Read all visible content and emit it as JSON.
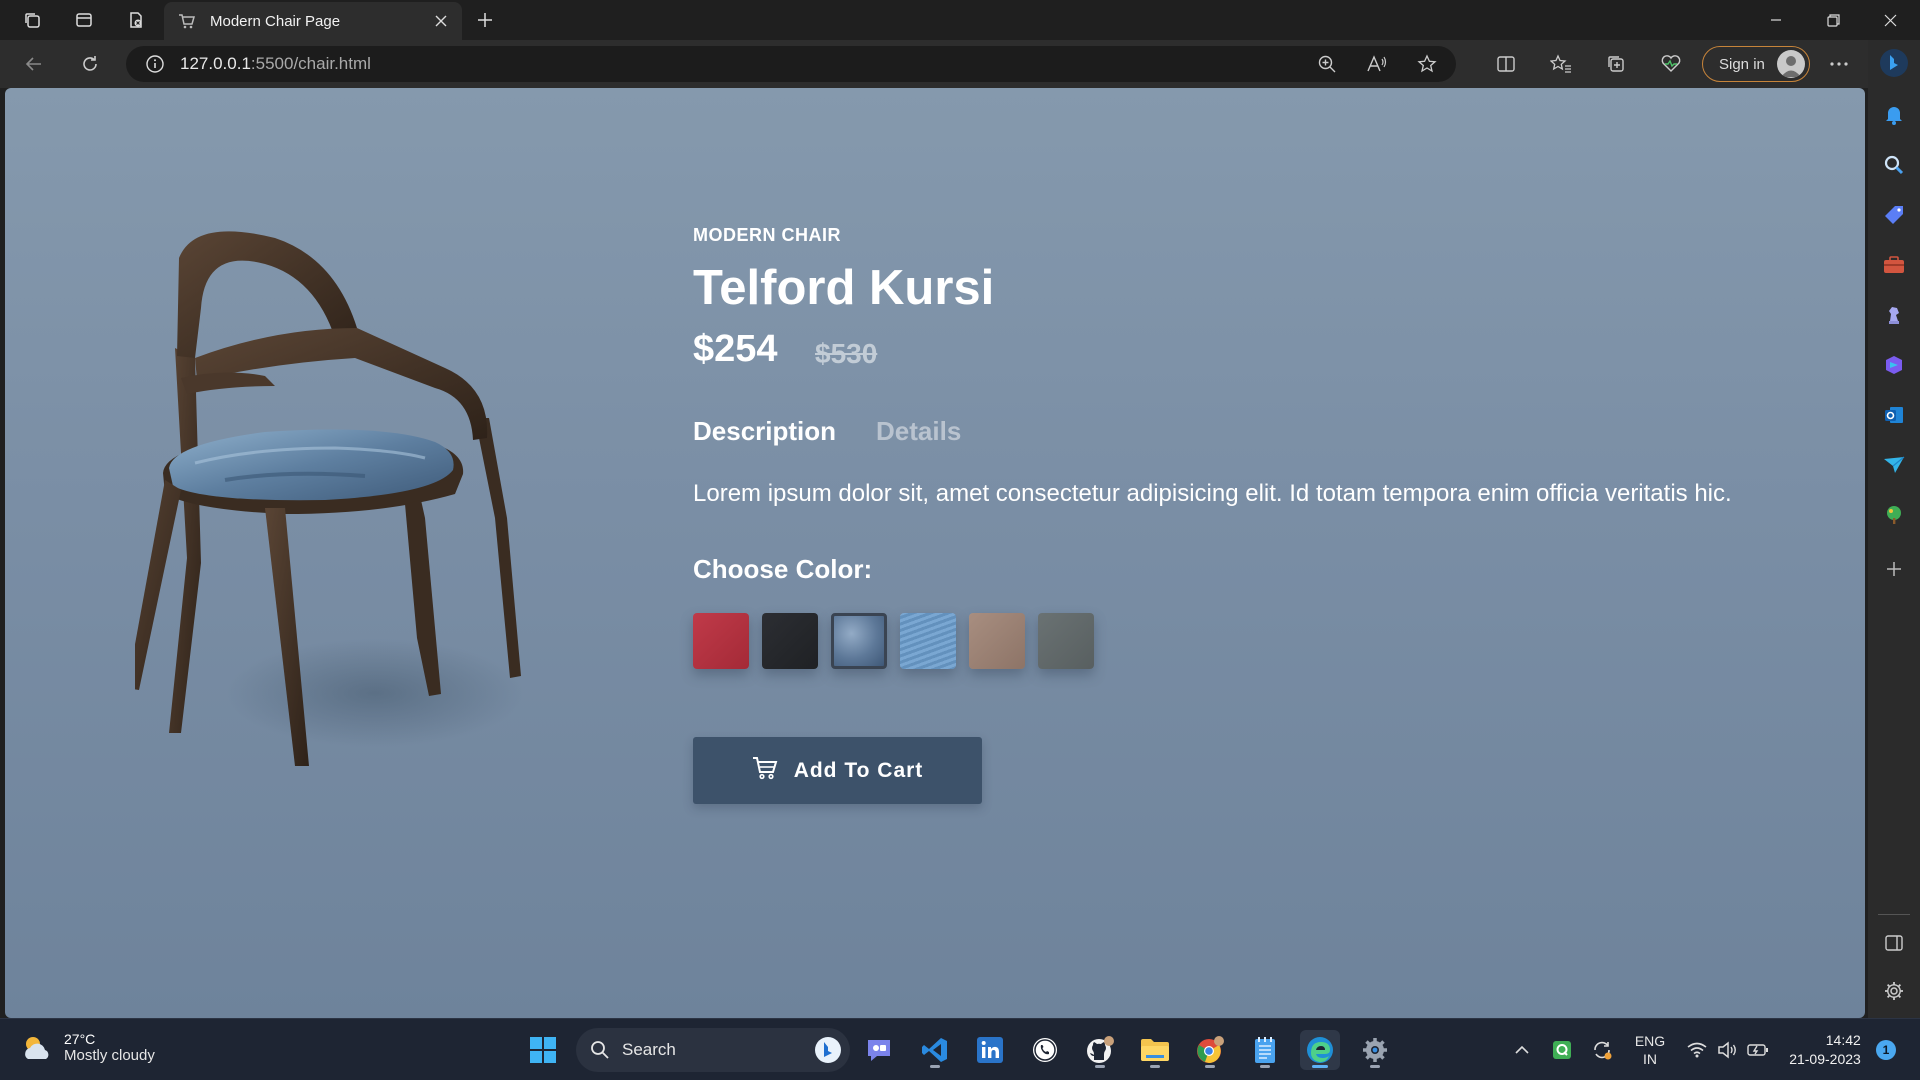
{
  "browser": {
    "tab_title": "Modern Chair Page",
    "url_host": "127.0.0.1",
    "url_rest": ":5500/chair.html",
    "signin_label": "Sign in"
  },
  "product": {
    "eyebrow": "MODERN CHAIR",
    "title": "Telford Kursi",
    "price": "$254",
    "old_price": "$530",
    "tabs": [
      {
        "label": "Description",
        "active": true
      },
      {
        "label": "Details",
        "active": false
      }
    ],
    "description": "Lorem ipsum dolor sit, amet consectetur adipisicing elit. Id totam tempora enim officia veritatis hic.",
    "color_label": "Choose Color:",
    "colors": [
      "red",
      "black",
      "blue",
      "light-blue",
      "beige",
      "gray"
    ],
    "selected_color": "blue",
    "cart_label": "Add To Cart"
  },
  "taskbar": {
    "weather_temp": "27°C",
    "weather_cond": "Mostly cloudy",
    "search_label": "Search",
    "lang_line1": "ENG",
    "lang_line2": "IN",
    "time": "14:42",
    "date": "21-09-2023",
    "notification_count": "1"
  },
  "colors": {
    "accent_signin_border": "#c7843a",
    "page_bg": "#7d91a7",
    "cart_button": "#3d526a",
    "swatch_red": "#b8313f",
    "swatch_black": "#25272b",
    "swatch_blue": "#5d7898",
    "swatch_light_blue": "#6e9bc6",
    "swatch_beige": "#9c8476",
    "swatch_gray": "#626a6b"
  }
}
